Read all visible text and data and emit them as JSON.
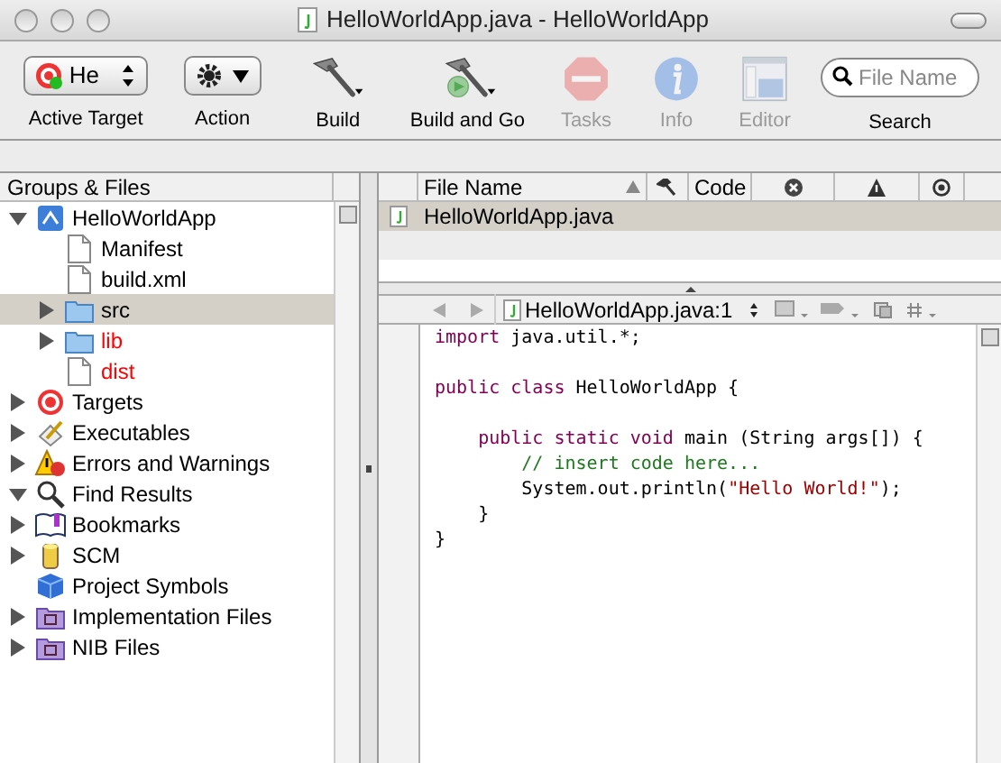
{
  "window": {
    "title": "HelloWorldApp.java - HelloWorldApp"
  },
  "toolbar": [
    {
      "kind": "target",
      "label": "Active Target",
      "value": "He",
      "disabled": false
    },
    {
      "kind": "action",
      "label": "Action",
      "disabled": false
    },
    {
      "kind": "build",
      "label": "Build",
      "disabled": false
    },
    {
      "kind": "buildgo",
      "label": "Build and Go",
      "disabled": false
    },
    {
      "kind": "tasks",
      "label": "Tasks",
      "disabled": true
    },
    {
      "kind": "info",
      "label": "Info",
      "disabled": true
    },
    {
      "kind": "editor",
      "label": "Editor",
      "disabled": true
    },
    {
      "kind": "search",
      "label": "Search",
      "placeholder": "File Name",
      "disabled": false
    }
  ],
  "sidebar": {
    "title": "Groups & Files",
    "items": [
      {
        "label": "HelloWorldApp",
        "kind": "project",
        "expanded": true,
        "selected": false,
        "children": [
          {
            "label": "Manifest",
            "kind": "file",
            "selected": false
          },
          {
            "label": "build.xml",
            "kind": "file",
            "selected": false
          },
          {
            "label": "src",
            "kind": "folder",
            "expanded": false,
            "selected": true
          },
          {
            "label": "lib",
            "kind": "folder",
            "expanded": false,
            "selected": false,
            "color": "#ff0000"
          },
          {
            "label": "dist",
            "kind": "file",
            "selected": false,
            "color": "#ff0000"
          }
        ]
      },
      {
        "label": "Targets",
        "kind": "targets",
        "expanded": false,
        "selected": false
      },
      {
        "label": "Executables",
        "kind": "executables",
        "expanded": false,
        "selected": false
      },
      {
        "label": "Errors and Warnings",
        "kind": "warnings",
        "expanded": false,
        "selected": false
      },
      {
        "label": "Find Results",
        "kind": "find",
        "expanded": true,
        "selected": false
      },
      {
        "label": "Bookmarks",
        "kind": "bookmarks",
        "expanded": false,
        "selected": false
      },
      {
        "label": "SCM",
        "kind": "scm",
        "expanded": false,
        "selected": false
      },
      {
        "label": "Project Symbols",
        "kind": "symbols",
        "selected": false
      },
      {
        "label": "Implementation Files",
        "kind": "smart",
        "expanded": false,
        "selected": false
      },
      {
        "label": "NIB Files",
        "kind": "smart",
        "expanded": false,
        "selected": false
      }
    ]
  },
  "table": {
    "columns": [
      {
        "kind": "text",
        "label": "File Name",
        "sorted": true
      },
      {
        "kind": "build"
      },
      {
        "kind": "text",
        "label": "Code"
      },
      {
        "kind": "errors"
      },
      {
        "kind": "warnings"
      },
      {
        "kind": "target"
      }
    ],
    "rows": [
      {
        "name": "HelloWorldApp.java",
        "selected": true
      }
    ]
  },
  "editor": {
    "file": "HelloWorldApp.java:1",
    "lines": [
      {
        "kind": "code",
        "tokens": [
          {
            "text": "import",
            "kind": "keyword"
          },
          {
            "text": " java.util.*;",
            "kind": "plain"
          }
        ]
      },
      {
        "kind": "blank"
      },
      {
        "kind": "code",
        "tokens": [
          {
            "text": "public class",
            "kind": "keyword"
          },
          {
            "text": " HelloWorldApp {",
            "kind": "plain"
          }
        ]
      },
      {
        "kind": "blank"
      },
      {
        "kind": "code",
        "tokens": [
          {
            "text": "    public static void",
            "kind": "keyword"
          },
          {
            "text": " main (String args[]) {",
            "kind": "plain"
          }
        ]
      },
      {
        "kind": "code",
        "tokens": [
          {
            "text": "        // insert code here...",
            "kind": "comment"
          }
        ]
      },
      {
        "kind": "code",
        "tokens": [
          {
            "text": "        System.out.println(",
            "kind": "plain"
          },
          {
            "text": "\"Hello World!\"",
            "kind": "string"
          },
          {
            "text": ");",
            "kind": "plain"
          }
        ]
      },
      {
        "kind": "code",
        "tokens": [
          {
            "text": "    }",
            "kind": "plain"
          }
        ]
      },
      {
        "kind": "code",
        "tokens": [
          {
            "text": "}",
            "kind": "plain"
          }
        ]
      }
    ]
  }
}
